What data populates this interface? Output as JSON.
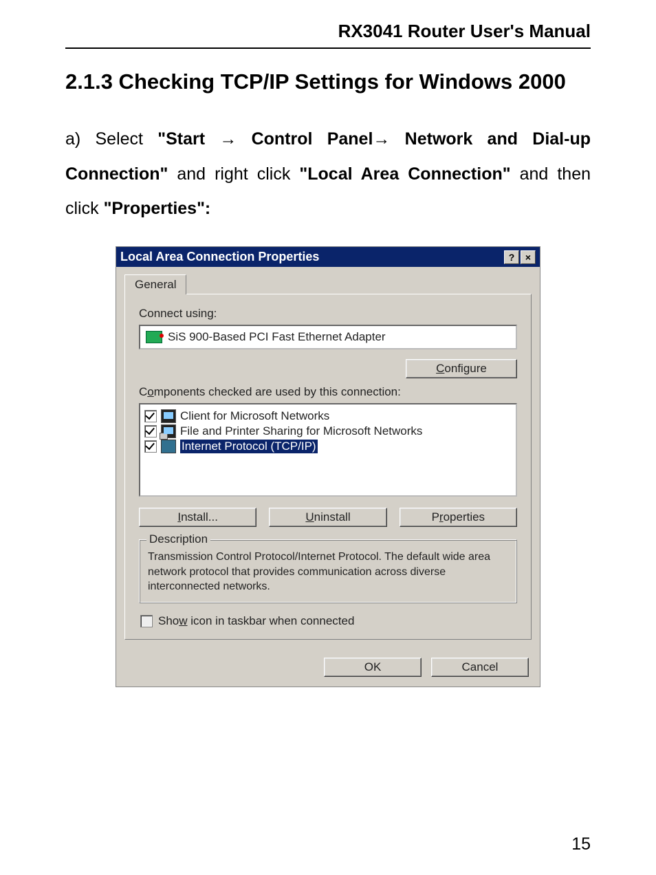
{
  "doc": {
    "header": "RX3041 Router User's Manual",
    "section_heading": "2.1.3 Checking TCP/IP Settings for Windows 2000",
    "para_a_prefix": "a) Select ",
    "bold1": "\"Start ",
    "arrow": "→",
    "bold2": " Control Panel",
    "bold3": " Network and Dial-up Connection\"",
    "mid1": " and right click ",
    "bold4": "\"Local Area Connection\"",
    "mid2": " and then click ",
    "bold5": "\"Properties\":",
    "page_number": "15"
  },
  "dialog": {
    "title": "Local Area Connection Properties",
    "help_btn": "?",
    "close_btn": "×",
    "tab_general": "General",
    "connect_using_label": "Connect using:",
    "adapter_name": "SiS 900-Based PCI Fast Ethernet Adapter",
    "configure_btn": "Configure",
    "components_label": "Components checked are used by this connection:",
    "components": [
      {
        "label": "Client for Microsoft Networks"
      },
      {
        "label": "File and Printer Sharing for Microsoft Networks"
      },
      {
        "label": "Internet Protocol (TCP/IP)"
      }
    ],
    "install_btn": "Install...",
    "uninstall_btn": "Uninstall",
    "properties_btn": "Properties",
    "description_legend": "Description",
    "description_text": "Transmission Control Protocol/Internet Protocol. The default wide area network protocol that provides communication across diverse interconnected networks.",
    "show_icon_label": "Show icon in taskbar when connected",
    "ok_btn": "OK",
    "cancel_btn": "Cancel"
  }
}
